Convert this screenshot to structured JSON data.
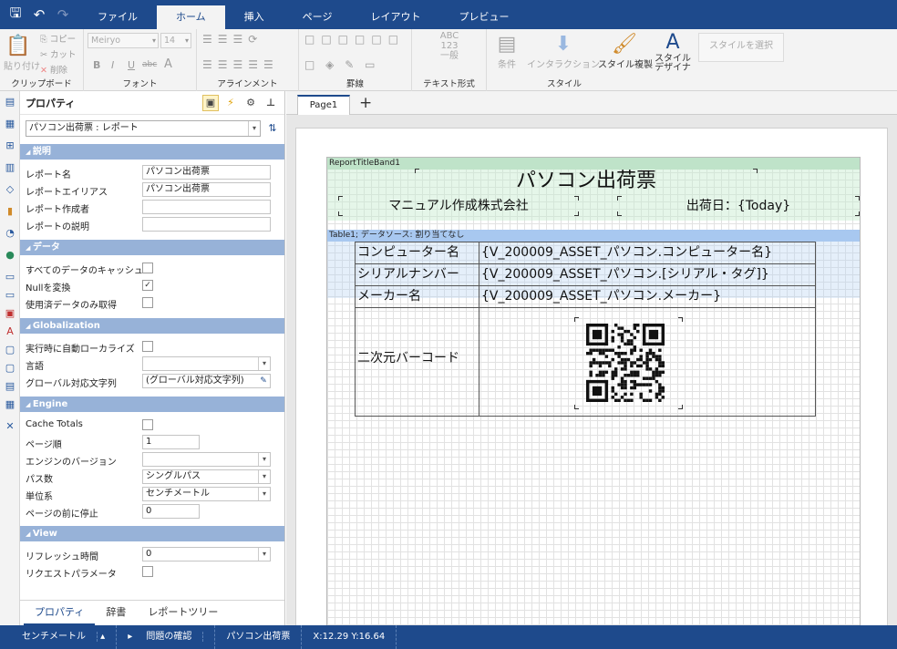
{
  "titlebar": {
    "quick_access": [
      "save-icon",
      "undo-icon",
      "redo-icon"
    ],
    "tabs": [
      {
        "label": "ファイル"
      },
      {
        "label": "ホーム",
        "active": true
      },
      {
        "label": "挿入"
      },
      {
        "label": "ページ"
      },
      {
        "label": "レイアウト"
      },
      {
        "label": "プレビュー"
      }
    ]
  },
  "ribbon": {
    "clipboard": {
      "paste": "貼り付け",
      "copy": "コピー",
      "cut": "カット",
      "delete": "削除",
      "label": "クリップボード"
    },
    "font": {
      "family": "Meiryo",
      "size": "14",
      "bold": "B",
      "italic": "I",
      "underline": "U",
      "strike": "abc",
      "color": "A",
      "label": "フォント"
    },
    "alignment": {
      "label": "アラインメント"
    },
    "border": {
      "label": "罫線"
    },
    "text_format": {
      "sample_top": "ABC",
      "sample_mid": "123",
      "general": "一般",
      "label": "テキスト形式"
    },
    "style": {
      "condition": "条件",
      "interaction": "インタラクション",
      "copy_style": "スタイル複製",
      "designer_line1": "スタイル",
      "designer_line2": "デザイナ",
      "select_style": "スタイルを選択",
      "label": "スタイル"
    }
  },
  "properties": {
    "title": "プロパティ",
    "selector": "パソコン出荷票 : レポート",
    "sections": {
      "description": {
        "label": "説明",
        "rows": [
          {
            "label": "レポート名",
            "value": "パソコン出荷票"
          },
          {
            "label": "レポートエイリアス",
            "value": "パソコン出荷票"
          },
          {
            "label": "レポート作成者",
            "value": ""
          },
          {
            "label": "レポートの説明",
            "value": ""
          }
        ]
      },
      "data": {
        "label": "データ",
        "rows": [
          {
            "label": "すべてのデータのキャッシュ",
            "checked": false
          },
          {
            "label": "Nullを変換",
            "checked": true
          },
          {
            "label": "使用済データのみ取得",
            "checked": false
          }
        ]
      },
      "globalization": {
        "label": "Globalization",
        "rows": [
          {
            "label": "実行時に自動ローカライズ",
            "checked": false
          },
          {
            "label": "言語",
            "value": ""
          },
          {
            "label": "グローバル対応文字列",
            "value": "(グローバル対応文字列)"
          }
        ]
      },
      "engine": {
        "label": "Engine",
        "rows": [
          {
            "label": "Cache Totals",
            "checked": false
          },
          {
            "label": "ページ順",
            "value": "1"
          },
          {
            "label": "エンジンのバージョン",
            "value": ""
          },
          {
            "label": "パス数",
            "value": "シングルパス"
          },
          {
            "label": "単位系",
            "value": "センチメートル"
          },
          {
            "label": "ページの前に停止",
            "value": "0"
          }
        ]
      },
      "view": {
        "label": "View",
        "rows": [
          {
            "label": "リフレッシュ時間",
            "value": "0"
          },
          {
            "label": "リクエストパラメータ",
            "checked": false
          }
        ]
      }
    },
    "bottom_tabs": [
      {
        "label": "プロパティ",
        "active": true
      },
      {
        "label": "辞書"
      },
      {
        "label": "レポートツリー"
      }
    ]
  },
  "designer": {
    "page_tab": "Page1",
    "add_page": "+",
    "band1_name": "ReportTitleBand1",
    "report_title": "パソコン出荷票",
    "company": "マニュアル作成株式会社",
    "ship_date": "出荷日：{Today}",
    "band2_name": "Table1; データソース: 割り当てなし",
    "table": [
      {
        "label": "コンピューター名",
        "value": "{V_200009_ASSET_パソコン.コンピューター名}"
      },
      {
        "label": "シリアルナンバー",
        "value": "{V_200009_ASSET_パソコン.[シリアル・タグ]}"
      },
      {
        "label": "メーカー名",
        "value": "{V_200009_ASSET_パソコン.メーカー}"
      },
      {
        "label": "二次元バーコード",
        "value": ""
      }
    ]
  },
  "status": {
    "unit": "センチメートル",
    "check": "問題の確認",
    "report": "パソコン出荷票",
    "coords": "X:12.29 Y:16.64"
  },
  "colors": {
    "accent": "#1e4a8c",
    "band_title": "#bfe3c9",
    "band_table": "#a8c8f0",
    "section": "#97b2d8"
  }
}
